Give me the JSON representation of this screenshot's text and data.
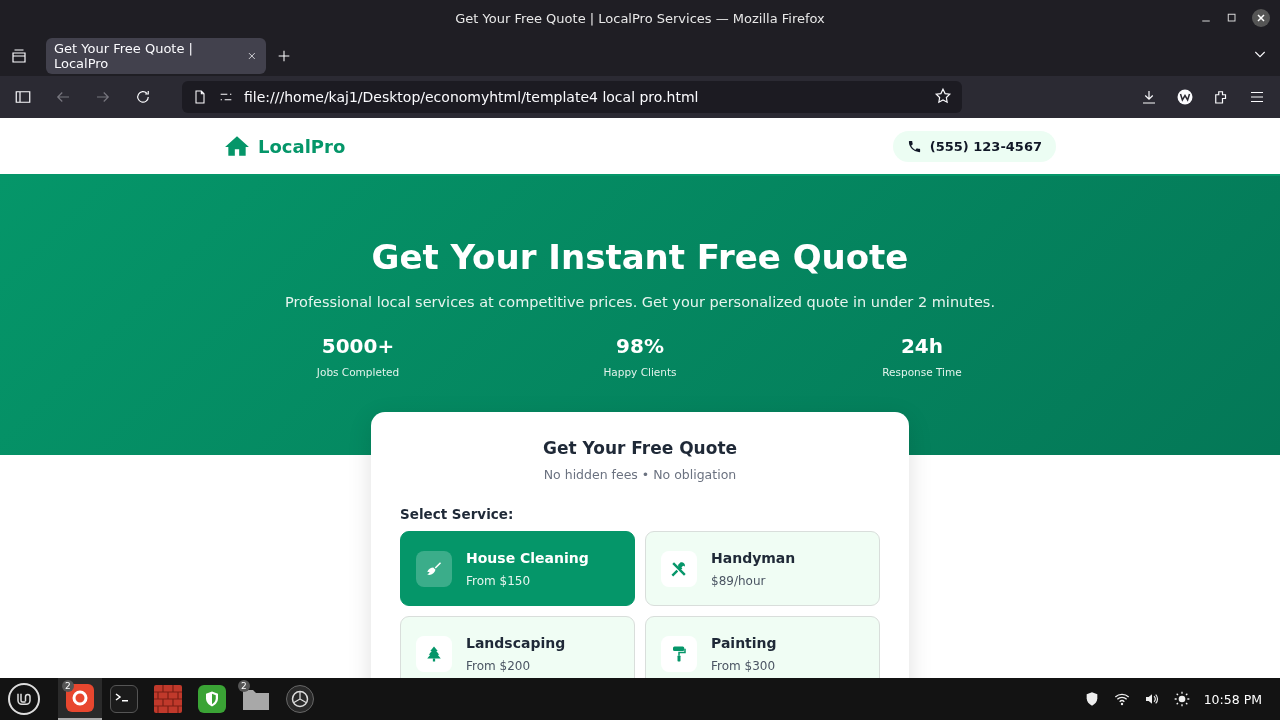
{
  "window": {
    "title": "Get Your Free Quote | LocalPro Services — Mozilla Firefox"
  },
  "tabs": [
    {
      "label": "Get Your Free Quote | LocalPro",
      "selected": true
    }
  ],
  "address_bar": {
    "url": "file:///home/kaj1/Desktop/economyhtml/template4 local pro.html"
  },
  "header": {
    "brand": "LocalPro",
    "phone": "(555) 123-4567"
  },
  "hero": {
    "title": "Get Your Instant Free Quote",
    "subtitle": "Professional local services at competitive prices. Get your personalized quote in under 2 minutes.",
    "stats": [
      {
        "value": "5000+",
        "label": "Jobs Completed"
      },
      {
        "value": "98%",
        "label": "Happy Clients"
      },
      {
        "value": "24h",
        "label": "Response Time"
      }
    ]
  },
  "quote_card": {
    "title": "Get Your Free Quote",
    "subtitle": "No hidden fees • No obligation",
    "service_label": "Select Service:",
    "services": [
      {
        "kind": "cleaning",
        "name": "House Cleaning",
        "price": "From $150",
        "selected": true
      },
      {
        "kind": "handyman",
        "name": "Handyman",
        "price": "$89/hour",
        "selected": false
      },
      {
        "kind": "landscaping",
        "name": "Landscaping",
        "price": "From $200",
        "selected": false
      },
      {
        "kind": "painting",
        "name": "Painting",
        "price": "From $300",
        "selected": false
      }
    ]
  },
  "taskbar": {
    "apps": [
      {
        "kind": "firefox",
        "badge": "2",
        "selected": true
      },
      {
        "kind": "terminal",
        "selected": false
      },
      {
        "kind": "firewall",
        "selected": false
      },
      {
        "kind": "shield",
        "selected": false
      },
      {
        "kind": "files",
        "badge": "2",
        "selected": false
      },
      {
        "kind": "obs",
        "selected": false
      }
    ],
    "clock": "10:58 PM"
  }
}
